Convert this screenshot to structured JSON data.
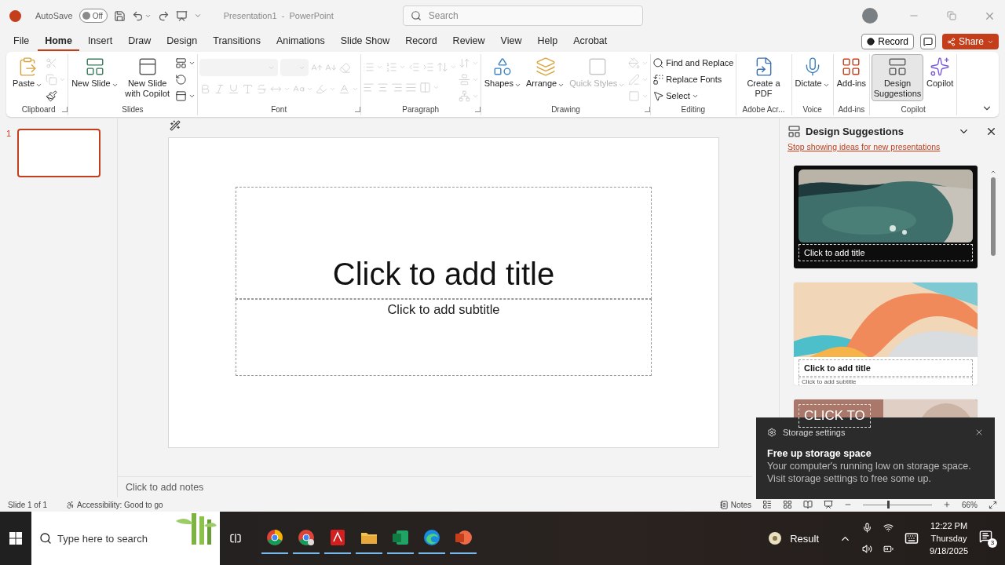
{
  "title_bar": {
    "autosave_label": "AutoSave",
    "autosave": {
      "on": false,
      "label": "Off"
    },
    "document_title": "Presentation1  -  PowerPoint",
    "search": {
      "placeholder": "Search"
    }
  },
  "menu_tabs": [
    {
      "label": "File",
      "selected": false
    },
    {
      "label": "Home",
      "selected": true
    },
    {
      "label": "Insert",
      "selected": false
    },
    {
      "label": "Draw",
      "selected": false
    },
    {
      "label": "Design",
      "selected": false
    },
    {
      "label": "Transitions",
      "selected": false
    },
    {
      "label": "Animations",
      "selected": false
    },
    {
      "label": "Slide Show",
      "selected": false
    },
    {
      "label": "Record",
      "selected": false
    },
    {
      "label": "Review",
      "selected": false
    },
    {
      "label": "View",
      "selected": false
    },
    {
      "label": "Help",
      "selected": false
    },
    {
      "label": "Acrobat",
      "selected": false
    }
  ],
  "record_button": "Record",
  "share_button": "Share",
  "ribbon": [
    {
      "label": "Clipboard",
      "launcher": true,
      "parts": [
        {
          "kind": "large",
          "label": "Paste",
          "caret": true,
          "disabled": false
        },
        {
          "kind": "stack",
          "items": [
            {
              "caret": false,
              "disabled": true
            },
            {
              "caret": true,
              "disabled": true
            },
            {
              "caret": false,
              "disabled": false
            }
          ]
        }
      ]
    },
    {
      "label": "Slides",
      "launcher": false,
      "parts": [
        {
          "kind": "large",
          "label": "New Slide",
          "caret": true,
          "disabled": false
        },
        {
          "kind": "large",
          "label": "New Slide with Copilot",
          "caret": false,
          "disabled": false
        },
        {
          "kind": "stack",
          "items": [
            {
              "caret": true,
              "disabled": false
            },
            {
              "caret": false,
              "disabled": false
            },
            {
              "caret": true,
              "disabled": false
            }
          ]
        }
      ]
    },
    {
      "label": "Font",
      "launcher": true,
      "parts": [
        {
          "kind": "rows",
          "rows": [
            [
              {
                "kind": "field",
                "caret": true,
                "disabled": true
              },
              {
                "kind": "field",
                "caret": true,
                "disabled": true
              },
              {
                "kind": "tool",
                "caret": false,
                "disabled": true
              },
              {
                "kind": "tool",
                "caret": false,
                "disabled": true
              },
              {
                "kind": "tool",
                "caret": false,
                "disabled": true
              }
            ],
            [
              {
                "kind": "tool",
                "caret": false,
                "disabled": true
              },
              {
                "kind": "tool",
                "caret": false,
                "disabled": true
              },
              {
                "kind": "tool",
                "caret": false,
                "disabled": true
              },
              {
                "kind": "tool",
                "caret": false,
                "disabled": true
              },
              {
                "kind": "tool",
                "caret": false,
                "disabled": true
              },
              {
                "kind": "tool",
                "caret": true,
                "disabled": true
              },
              {
                "kind": "tool",
                "caret": true,
                "disabled": true
              },
              {
                "kind": "tool",
                "caret": true,
                "disabled": true
              },
              {
                "kind": "tool",
                "caret": true,
                "disabled": true
              }
            ]
          ]
        }
      ]
    },
    {
      "label": "Paragraph",
      "launcher": true,
      "parts": [
        {
          "kind": "rows",
          "rows": [
            [
              {
                "kind": "tool",
                "caret": true,
                "disabled": true
              },
              {
                "kind": "tool",
                "caret": true,
                "disabled": true
              },
              {
                "kind": "tool",
                "caret": false,
                "disabled": true
              },
              {
                "kind": "tool",
                "caret": false,
                "disabled": true
              },
              {
                "kind": "tool",
                "caret": true,
                "disabled": true
              }
            ],
            [
              {
                "kind": "tool",
                "caret": false,
                "disabled": true
              },
              {
                "kind": "tool",
                "caret": false,
                "disabled": true
              },
              {
                "kind": "tool",
                "caret": false,
                "disabled": true
              },
              {
                "kind": "tool",
                "caret": false,
                "disabled": true
              },
              {
                "kind": "tool",
                "caret": true,
                "disabled": true
              }
            ]
          ]
        },
        {
          "kind": "stack",
          "items": [
            {
              "caret": true,
              "disabled": true
            },
            {
              "caret": true,
              "disabled": true
            },
            {
              "caret": true,
              "disabled": true
            }
          ]
        }
      ]
    },
    {
      "label": "Drawing",
      "launcher": true,
      "parts": [
        {
          "kind": "large",
          "label": "Shapes",
          "caret": true,
          "disabled": false
        },
        {
          "kind": "large",
          "label": "Arrange",
          "caret": true,
          "disabled": false
        },
        {
          "kind": "large",
          "label": "Quick Styles",
          "caret": true,
          "disabled": true
        },
        {
          "kind": "stack",
          "items": [
            {
              "caret": true,
              "disabled": true
            },
            {
              "caret": true,
              "disabled": true
            },
            {
              "caret": true,
              "disabled": true
            }
          ]
        }
      ]
    },
    {
      "label": "Editing",
      "launcher": false,
      "parts": [
        {
          "kind": "stack",
          "items": [
            {
              "label": "Find and Replace",
              "caret": false,
              "disabled": false
            },
            {
              "label": "Replace Fonts",
              "caret": false,
              "disabled": false
            },
            {
              "label": "Select",
              "caret": true,
              "disabled": false
            }
          ]
        }
      ]
    },
    {
      "label": "Adobe Acr...",
      "launcher": false,
      "parts": [
        {
          "kind": "large",
          "label": "Create a PDF",
          "caret": false,
          "disabled": false
        }
      ]
    },
    {
      "label": "Voice",
      "launcher": false,
      "parts": [
        {
          "kind": "large",
          "label": "Dictate",
          "caret": true,
          "disabled": false
        }
      ]
    },
    {
      "label": "Add-ins",
      "launcher": false,
      "parts": [
        {
          "kind": "large",
          "label": "Add-ins",
          "caret": false,
          "disabled": false
        }
      ]
    },
    {
      "label": "Copilot",
      "launcher": false,
      "parts": [
        {
          "kind": "large",
          "label": "Design Suggestions",
          "caret": false,
          "disabled": false,
          "pressed": true
        },
        {
          "kind": "large",
          "label": "Copilot",
          "caret": false,
          "disabled": false,
          "pressed": false
        }
      ]
    }
  ],
  "thumbnails": [
    {
      "number": "1",
      "selected": true
    }
  ],
  "slide": {
    "title_placeholder": "Click to add title",
    "subtitle_placeholder": "Click to add subtitle"
  },
  "notes_placeholder": "Click to add notes",
  "design_panel": {
    "title": "Design Suggestions",
    "link": "Stop showing ideas for new presentations",
    "cards": [
      {
        "kind": "dark",
        "title": "Click to add title"
      },
      {
        "kind": "light",
        "title": "Click to add title",
        "subtitle": "Click to add subtitle"
      },
      {
        "kind": "split",
        "title": "CLICK TO"
      }
    ]
  },
  "status_bar": {
    "slide_info": "Slide 1 of 1",
    "accessibility": "Accessibility: Good to go",
    "notes_button": "Notes",
    "zoom": {
      "level": 0.35,
      "reading": "66%"
    }
  },
  "taskbar": {
    "search": {
      "placeholder": "Type here to search"
    },
    "weather": "Result",
    "time": "12:22 PM",
    "day": "Thursday",
    "date": "9/18/2025",
    "notification_count": "3"
  },
  "toast": {
    "app": "Storage settings",
    "title": "Free up storage space",
    "message": "Your computer's running low on storage space. Visit storage settings to free some up."
  }
}
